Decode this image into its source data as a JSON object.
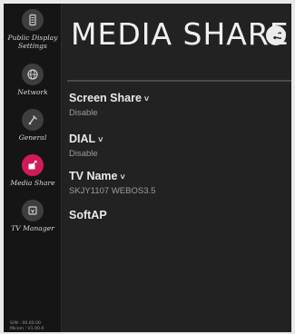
{
  "sidebar": {
    "items": [
      {
        "label": "Public Display\nSettings",
        "icon": "display-settings-icon",
        "active": false
      },
      {
        "label": "Network",
        "icon": "network-globe-icon",
        "active": false
      },
      {
        "label": "General",
        "icon": "general-settings-icon",
        "active": false
      },
      {
        "label": "Media Share",
        "icon": "media-share-icon",
        "active": true
      },
      {
        "label": "TV Manager",
        "icon": "tv-manager-icon",
        "active": false
      }
    ],
    "version_line1": "S/W : 00.00.00",
    "version_line2": "Micom : V1.00.0"
  },
  "header": {
    "title": "MEDIA SHARE",
    "back_icon": "back-arrow-icon"
  },
  "sections": [
    {
      "label": "Screen Share",
      "chevron": "˅",
      "value": "Disable"
    },
    {
      "label": "DIAL",
      "chevron": "˅",
      "value": "Disable"
    },
    {
      "label": "TV Name",
      "chevron": "˅",
      "value": "SKJY1107 WEBOS3.5"
    },
    {
      "label": "SoftAP"
    }
  ],
  "colors": {
    "accent": "#d21a5a",
    "background": "#222222",
    "sidebar": "#151515"
  }
}
